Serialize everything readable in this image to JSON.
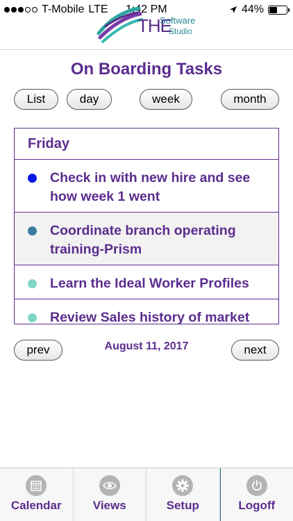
{
  "status_bar": {
    "carrier": "T-Mobile",
    "network": "LTE",
    "time": "1:42 PM",
    "battery_percent": "44%",
    "battery_level": 0.44,
    "signal_bars_filled": 3,
    "signal_bars_total": 5
  },
  "logo": {
    "line1": "THE",
    "line2": "Software",
    "line3": "Studio"
  },
  "page": {
    "title": "On Boarding Tasks"
  },
  "view_buttons": {
    "list": "List",
    "day": "day",
    "week": "week",
    "month": "month"
  },
  "task_list": {
    "day_heading": "Friday",
    "tasks": [
      {
        "text": "Check in with new hire and see how week 1 went",
        "dot_color": "#0a16e6"
      },
      {
        "text": "Coordinate branch operating training-Prism",
        "dot_color": "#3a7a9a"
      },
      {
        "text": "Learn the Ideal Worker Profiles",
        "dot_color": "#7fd6c6"
      },
      {
        "text": "Review Sales history of market",
        "dot_color": "#7fd6c6"
      }
    ]
  },
  "pager": {
    "prev_label": "prev",
    "date": "August 11, 2017",
    "next_label": "next"
  },
  "tab_bar": {
    "tabs": [
      {
        "label": "Calendar",
        "icon": "calendar-icon"
      },
      {
        "label": "Views",
        "icon": "eye-icon"
      },
      {
        "label": "Setup",
        "icon": "gear-icon"
      },
      {
        "label": "Logoff",
        "icon": "power-icon"
      }
    ]
  },
  "colors": {
    "brand_purple": "#5b2d8e",
    "icon_gray": "#b4b4b4"
  }
}
